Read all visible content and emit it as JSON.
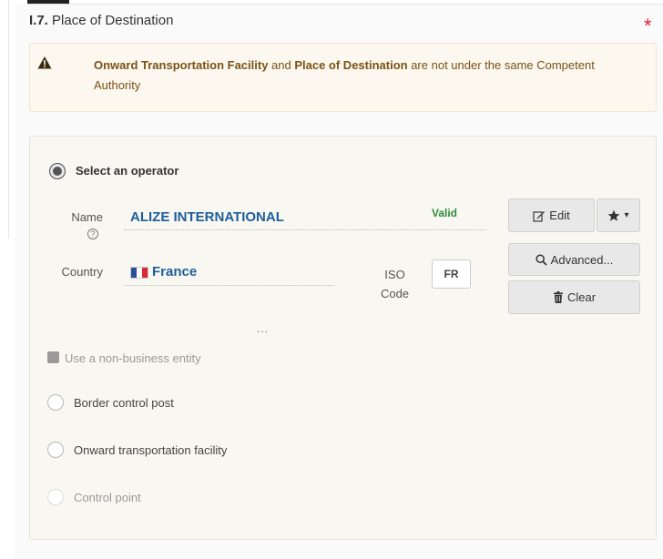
{
  "section": {
    "number": "I.7.",
    "title": "Place of Destination",
    "required_mark": "*"
  },
  "warning": {
    "icon": "warning-triangle-icon",
    "part1": "Onward Transportation Facility",
    "part2": " and ",
    "part3": "Place of Destination",
    "part4": " are not under the same Competent Authority"
  },
  "operator": {
    "option_label": "Select an operator",
    "name_label": "Name",
    "name_value": "ALIZE INTERNATIONAL",
    "status": "Valid",
    "country_label": "Country",
    "country_value": "France",
    "country_flag": "flag-france-icon",
    "iso_label_line1": "ISO",
    "iso_label_line2": "Code",
    "iso_value": "FR",
    "more": "..."
  },
  "buttons": {
    "edit": "Edit",
    "advanced": "Advanced...",
    "clear": "Clear",
    "favorite_caret": "▾"
  },
  "options": {
    "non_business": "Use a non-business entity",
    "border_post": "Border control post",
    "onward": "Onward transportation facility",
    "control_point": "Control point"
  },
  "colors": {
    "warning_text": "#7a5216",
    "name_link": "#1f5e9a",
    "valid": "#2e8b3a",
    "required": "#e0203a"
  }
}
